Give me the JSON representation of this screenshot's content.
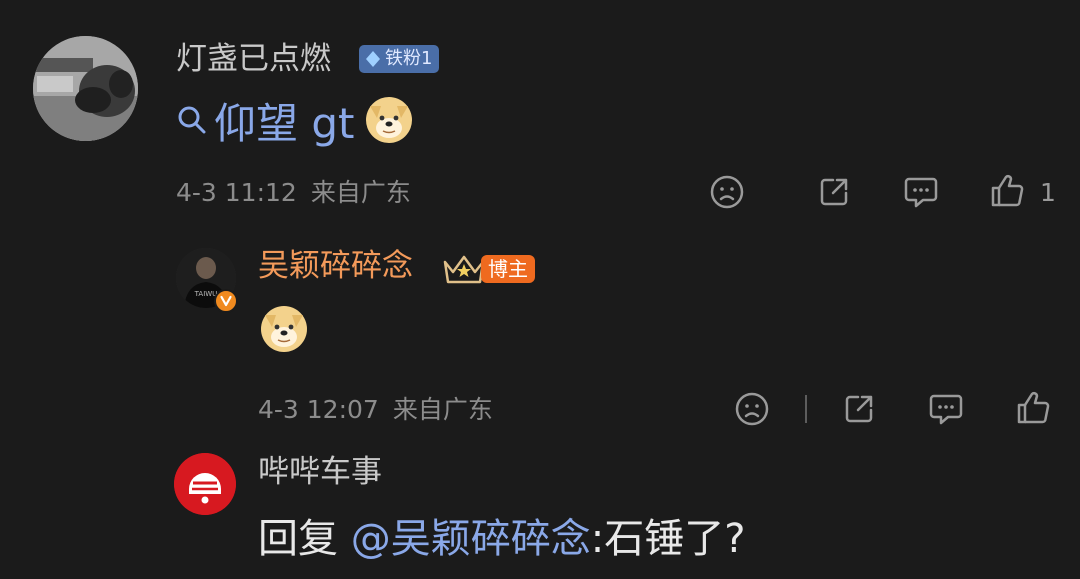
{
  "comment1": {
    "username": "灯盏已点燃",
    "fan_badge": "铁粉1",
    "search_text": "仰望 gt",
    "timestamp": "4-3 11:12",
    "location": "来自广东",
    "like_count": "1"
  },
  "reply1": {
    "username": "吴颖碎碎念",
    "host_badge": "博主",
    "avatar_shirt_text": "TAIWU",
    "timestamp": "4-3 12:07",
    "location": "来自广东"
  },
  "reply2": {
    "username": "哔哔车事",
    "reply_prefix": "回复",
    "mention": "@吴颖碎碎念",
    "content": ":石锤了?"
  },
  "colors": {
    "background": "#1b1b1b",
    "link_blue": "#8aa8e8",
    "host_orange": "#ef6a1f",
    "host_name": "#f39a5a"
  },
  "icons": [
    "sad-face-icon",
    "share-icon",
    "comment-icon",
    "thumbs-up-icon",
    "search-icon",
    "diamond-icon",
    "crown-icon",
    "verified-icon",
    "doge-emoji"
  ]
}
